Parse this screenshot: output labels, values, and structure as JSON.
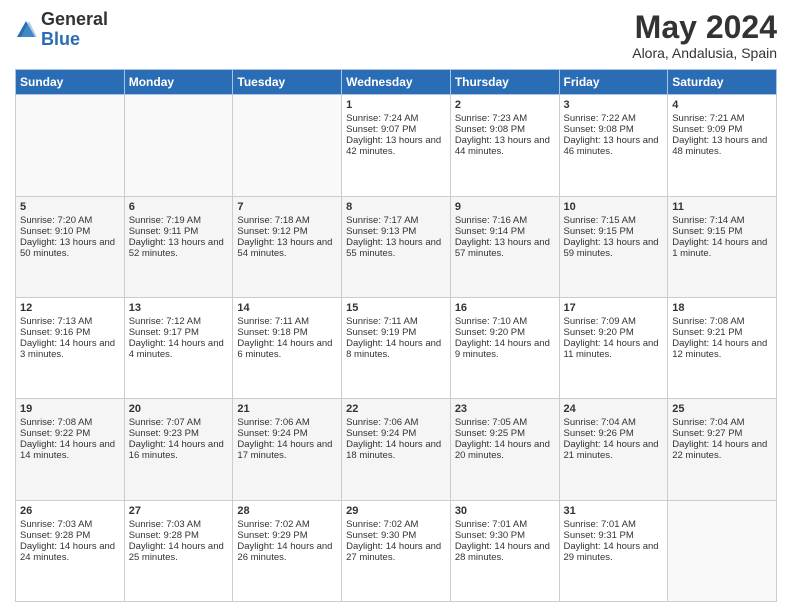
{
  "header": {
    "logo_general": "General",
    "logo_blue": "Blue",
    "month_year": "May 2024",
    "location": "Alora, Andalusia, Spain"
  },
  "days_of_week": [
    "Sunday",
    "Monday",
    "Tuesday",
    "Wednesday",
    "Thursday",
    "Friday",
    "Saturday"
  ],
  "weeks": [
    [
      {
        "day": "",
        "sunrise": "",
        "sunset": "",
        "daylight": ""
      },
      {
        "day": "",
        "sunrise": "",
        "sunset": "",
        "daylight": ""
      },
      {
        "day": "",
        "sunrise": "",
        "sunset": "",
        "daylight": ""
      },
      {
        "day": "1",
        "sunrise": "Sunrise: 7:24 AM",
        "sunset": "Sunset: 9:07 PM",
        "daylight": "Daylight: 13 hours and 42 minutes."
      },
      {
        "day": "2",
        "sunrise": "Sunrise: 7:23 AM",
        "sunset": "Sunset: 9:08 PM",
        "daylight": "Daylight: 13 hours and 44 minutes."
      },
      {
        "day": "3",
        "sunrise": "Sunrise: 7:22 AM",
        "sunset": "Sunset: 9:08 PM",
        "daylight": "Daylight: 13 hours and 46 minutes."
      },
      {
        "day": "4",
        "sunrise": "Sunrise: 7:21 AM",
        "sunset": "Sunset: 9:09 PM",
        "daylight": "Daylight: 13 hours and 48 minutes."
      }
    ],
    [
      {
        "day": "5",
        "sunrise": "Sunrise: 7:20 AM",
        "sunset": "Sunset: 9:10 PM",
        "daylight": "Daylight: 13 hours and 50 minutes."
      },
      {
        "day": "6",
        "sunrise": "Sunrise: 7:19 AM",
        "sunset": "Sunset: 9:11 PM",
        "daylight": "Daylight: 13 hours and 52 minutes."
      },
      {
        "day": "7",
        "sunrise": "Sunrise: 7:18 AM",
        "sunset": "Sunset: 9:12 PM",
        "daylight": "Daylight: 13 hours and 54 minutes."
      },
      {
        "day": "8",
        "sunrise": "Sunrise: 7:17 AM",
        "sunset": "Sunset: 9:13 PM",
        "daylight": "Daylight: 13 hours and 55 minutes."
      },
      {
        "day": "9",
        "sunrise": "Sunrise: 7:16 AM",
        "sunset": "Sunset: 9:14 PM",
        "daylight": "Daylight: 13 hours and 57 minutes."
      },
      {
        "day": "10",
        "sunrise": "Sunrise: 7:15 AM",
        "sunset": "Sunset: 9:15 PM",
        "daylight": "Daylight: 13 hours and 59 minutes."
      },
      {
        "day": "11",
        "sunrise": "Sunrise: 7:14 AM",
        "sunset": "Sunset: 9:15 PM",
        "daylight": "Daylight: 14 hours and 1 minute."
      }
    ],
    [
      {
        "day": "12",
        "sunrise": "Sunrise: 7:13 AM",
        "sunset": "Sunset: 9:16 PM",
        "daylight": "Daylight: 14 hours and 3 minutes."
      },
      {
        "day": "13",
        "sunrise": "Sunrise: 7:12 AM",
        "sunset": "Sunset: 9:17 PM",
        "daylight": "Daylight: 14 hours and 4 minutes."
      },
      {
        "day": "14",
        "sunrise": "Sunrise: 7:11 AM",
        "sunset": "Sunset: 9:18 PM",
        "daylight": "Daylight: 14 hours and 6 minutes."
      },
      {
        "day": "15",
        "sunrise": "Sunrise: 7:11 AM",
        "sunset": "Sunset: 9:19 PM",
        "daylight": "Daylight: 14 hours and 8 minutes."
      },
      {
        "day": "16",
        "sunrise": "Sunrise: 7:10 AM",
        "sunset": "Sunset: 9:20 PM",
        "daylight": "Daylight: 14 hours and 9 minutes."
      },
      {
        "day": "17",
        "sunrise": "Sunrise: 7:09 AM",
        "sunset": "Sunset: 9:20 PM",
        "daylight": "Daylight: 14 hours and 11 minutes."
      },
      {
        "day": "18",
        "sunrise": "Sunrise: 7:08 AM",
        "sunset": "Sunset: 9:21 PM",
        "daylight": "Daylight: 14 hours and 12 minutes."
      }
    ],
    [
      {
        "day": "19",
        "sunrise": "Sunrise: 7:08 AM",
        "sunset": "Sunset: 9:22 PM",
        "daylight": "Daylight: 14 hours and 14 minutes."
      },
      {
        "day": "20",
        "sunrise": "Sunrise: 7:07 AM",
        "sunset": "Sunset: 9:23 PM",
        "daylight": "Daylight: 14 hours and 16 minutes."
      },
      {
        "day": "21",
        "sunrise": "Sunrise: 7:06 AM",
        "sunset": "Sunset: 9:24 PM",
        "daylight": "Daylight: 14 hours and 17 minutes."
      },
      {
        "day": "22",
        "sunrise": "Sunrise: 7:06 AM",
        "sunset": "Sunset: 9:24 PM",
        "daylight": "Daylight: 14 hours and 18 minutes."
      },
      {
        "day": "23",
        "sunrise": "Sunrise: 7:05 AM",
        "sunset": "Sunset: 9:25 PM",
        "daylight": "Daylight: 14 hours and 20 minutes."
      },
      {
        "day": "24",
        "sunrise": "Sunrise: 7:04 AM",
        "sunset": "Sunset: 9:26 PM",
        "daylight": "Daylight: 14 hours and 21 minutes."
      },
      {
        "day": "25",
        "sunrise": "Sunrise: 7:04 AM",
        "sunset": "Sunset: 9:27 PM",
        "daylight": "Daylight: 14 hours and 22 minutes."
      }
    ],
    [
      {
        "day": "26",
        "sunrise": "Sunrise: 7:03 AM",
        "sunset": "Sunset: 9:28 PM",
        "daylight": "Daylight: 14 hours and 24 minutes."
      },
      {
        "day": "27",
        "sunrise": "Sunrise: 7:03 AM",
        "sunset": "Sunset: 9:28 PM",
        "daylight": "Daylight: 14 hours and 25 minutes."
      },
      {
        "day": "28",
        "sunrise": "Sunrise: 7:02 AM",
        "sunset": "Sunset: 9:29 PM",
        "daylight": "Daylight: 14 hours and 26 minutes."
      },
      {
        "day": "29",
        "sunrise": "Sunrise: 7:02 AM",
        "sunset": "Sunset: 9:30 PM",
        "daylight": "Daylight: 14 hours and 27 minutes."
      },
      {
        "day": "30",
        "sunrise": "Sunrise: 7:01 AM",
        "sunset": "Sunset: 9:30 PM",
        "daylight": "Daylight: 14 hours and 28 minutes."
      },
      {
        "day": "31",
        "sunrise": "Sunrise: 7:01 AM",
        "sunset": "Sunset: 9:31 PM",
        "daylight": "Daylight: 14 hours and 29 minutes."
      },
      {
        "day": "",
        "sunrise": "",
        "sunset": "",
        "daylight": ""
      }
    ]
  ]
}
